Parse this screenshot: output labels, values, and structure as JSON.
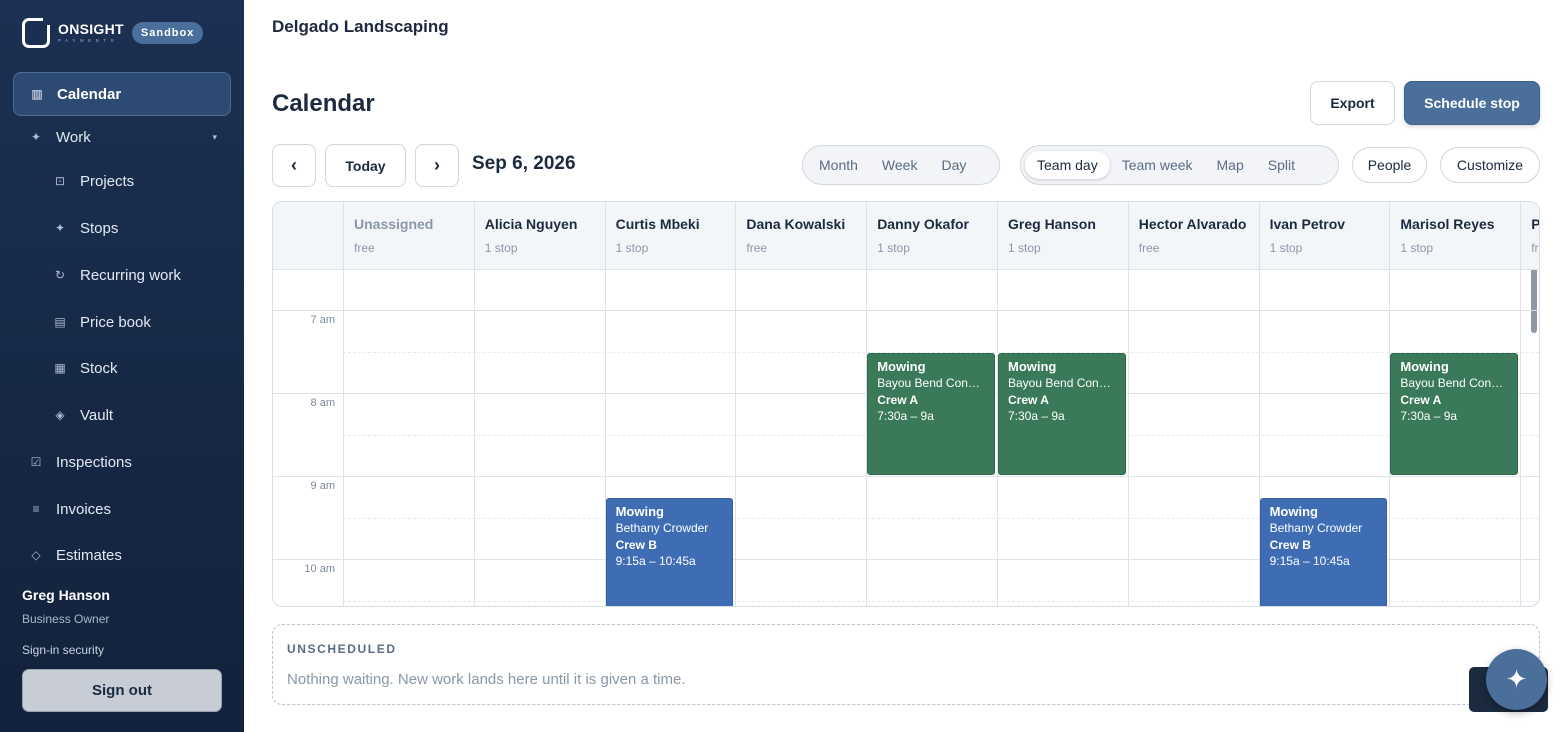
{
  "brand": {
    "name": "ONSIGHT",
    "sub": "PAYMENTS",
    "badge": "Sandbox"
  },
  "sidebar": {
    "items": [
      {
        "label": "Calendar",
        "icon": "calendar-icon"
      },
      {
        "label": "Work",
        "icon": "sparkle-icon"
      },
      {
        "label": "Projects",
        "icon": "folder-icon"
      },
      {
        "label": "Stops",
        "icon": "sparkle-icon"
      },
      {
        "label": "Recurring work",
        "icon": "refresh-icon"
      },
      {
        "label": "Price book",
        "icon": "book-icon"
      },
      {
        "label": "Stock",
        "icon": "grid-icon"
      },
      {
        "label": "Vault",
        "icon": "diamond-icon"
      },
      {
        "label": "Inspections",
        "icon": "checkbox-icon"
      },
      {
        "label": "Invoices",
        "icon": "list-icon"
      },
      {
        "label": "Estimates",
        "icon": "diamond-outline-icon"
      }
    ],
    "user": {
      "name": "Greg Hanson",
      "role": "Business Owner"
    },
    "signin_security": "Sign-in security",
    "signout": "Sign out"
  },
  "header": {
    "org": "Delgado Landscaping",
    "title": "Calendar",
    "export": "Export",
    "schedule": "Schedule stop"
  },
  "toolbar": {
    "prev": "‹",
    "today": "Today",
    "next": "›",
    "date": "Sep 6, 2026",
    "views": [
      "Month",
      "Week",
      "Day"
    ],
    "team_views": [
      "Team day",
      "Team week",
      "Map",
      "Split"
    ],
    "team_selected": "Team day",
    "people": "People",
    "customize": "Customize"
  },
  "calendar": {
    "columns": [
      {
        "name": "Unassigned",
        "count": "free"
      },
      {
        "name": "Alicia Nguyen",
        "count": "1 stop"
      },
      {
        "name": "Curtis Mbeki",
        "count": "1 stop"
      },
      {
        "name": "Dana Kowalski",
        "count": "free"
      },
      {
        "name": "Danny Okafor",
        "count": "1 stop"
      },
      {
        "name": "Greg Hanson",
        "count": "1 stop"
      },
      {
        "name": "Hector Alvarado",
        "count": "free"
      },
      {
        "name": "Ivan Petrov",
        "count": "1 stop"
      },
      {
        "name": "Marisol Reyes",
        "count": "1 stop"
      },
      {
        "name": "P",
        "count": "fr"
      }
    ],
    "hours": [
      "7 am",
      "8 am",
      "9 am",
      "10 am"
    ],
    "events": [
      {
        "column": 4,
        "title": "Mowing",
        "client": "Bayou Bend Condominiums",
        "crew": "Crew A",
        "time": "7:30a – 9a",
        "color": "green"
      },
      {
        "column": 5,
        "title": "Mowing",
        "client": "Bayou Bend Condominiums",
        "crew": "Crew A",
        "time": "7:30a – 9a",
        "color": "green"
      },
      {
        "column": 8,
        "title": "Mowing",
        "client": "Bayou Bend Condominiums",
        "crew": "Crew A",
        "time": "7:30a – 9a",
        "color": "green"
      },
      {
        "column": 2,
        "title": "Mowing",
        "client": "Bethany Crowder",
        "crew": "Crew B",
        "time": "9:15a – 10:45a",
        "color": "blue"
      },
      {
        "column": 7,
        "title": "Mowing",
        "client": "Bethany Crowder",
        "crew": "Crew B",
        "time": "9:15a – 10:45a",
        "color": "blue"
      }
    ]
  },
  "unscheduled": {
    "title": "UNSCHEDULED",
    "message": "Nothing waiting. New work lands here until it is given a time."
  },
  "fab": {
    "icon": "sparkle-icon"
  }
}
